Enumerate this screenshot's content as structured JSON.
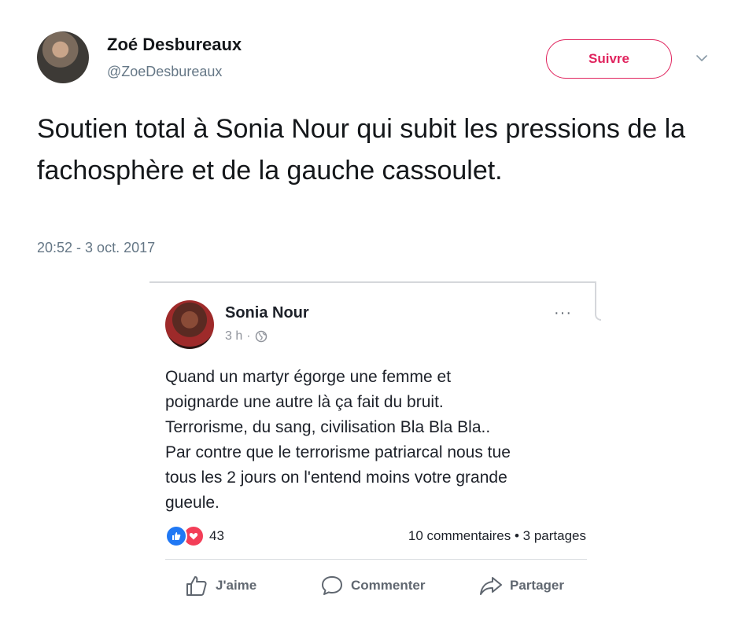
{
  "tweet": {
    "display_name": "Zoé Desbureaux",
    "handle": "@ZoeDesbureaux",
    "follow_label": "Suivre",
    "text": "Soutien total à Sonia Nour qui subit les pressions de la fachosphère et de la gauche cassoulet.",
    "timestamp": "20:52 - 3 oct. 2017",
    "colors": {
      "follow_accent": "#e0245e",
      "secondary_text": "#657786"
    },
    "icons": {
      "menu": "chevron-down-icon"
    }
  },
  "fb_post": {
    "author": "Sonia Nour",
    "time": "3 h",
    "separator": "·",
    "privacy_icon": "globe-icon",
    "more_label": "···",
    "text": "Quand un martyr égorge une femme et\npoignarde une autre là ça fait du bruit.\nTerrorisme, du sang, civilisation Bla Bla Bla..\nPar contre que le terrorisme patriarcal nous tue\ntous les 2 jours on l'entend moins votre grande\ngueule.",
    "reaction_count": "43",
    "counts": "10 commentaires • 3 partages",
    "actions": {
      "like": "J'aime",
      "comment": "Commenter",
      "share": "Partager"
    },
    "colors": {
      "like_reaction": "#2078f4",
      "love_reaction": "#f33e58"
    }
  }
}
